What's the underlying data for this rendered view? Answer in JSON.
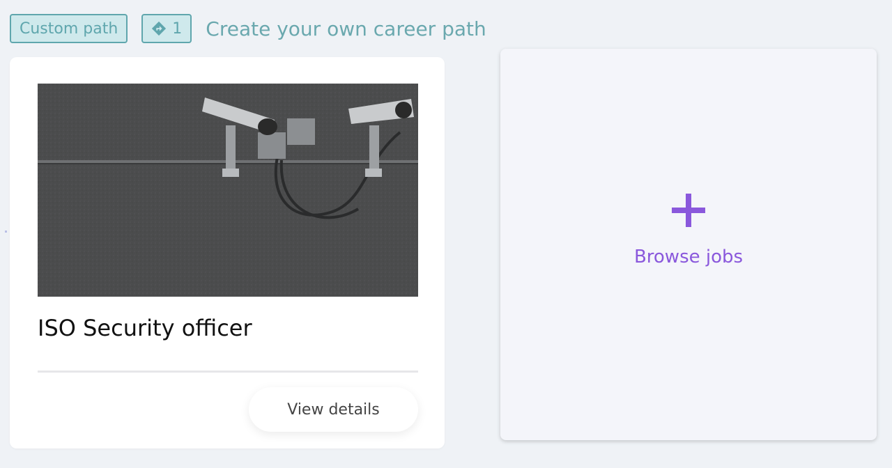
{
  "header": {
    "custom_tag": "Custom path",
    "count_tag": "1",
    "title": "Create your own career path"
  },
  "card": {
    "job_title": "ISO Security officer",
    "view_details": "View details"
  },
  "browse": {
    "label": "Browse jobs"
  },
  "colors": {
    "teal": "#5fa6ad",
    "purple": "#8a58dc"
  }
}
